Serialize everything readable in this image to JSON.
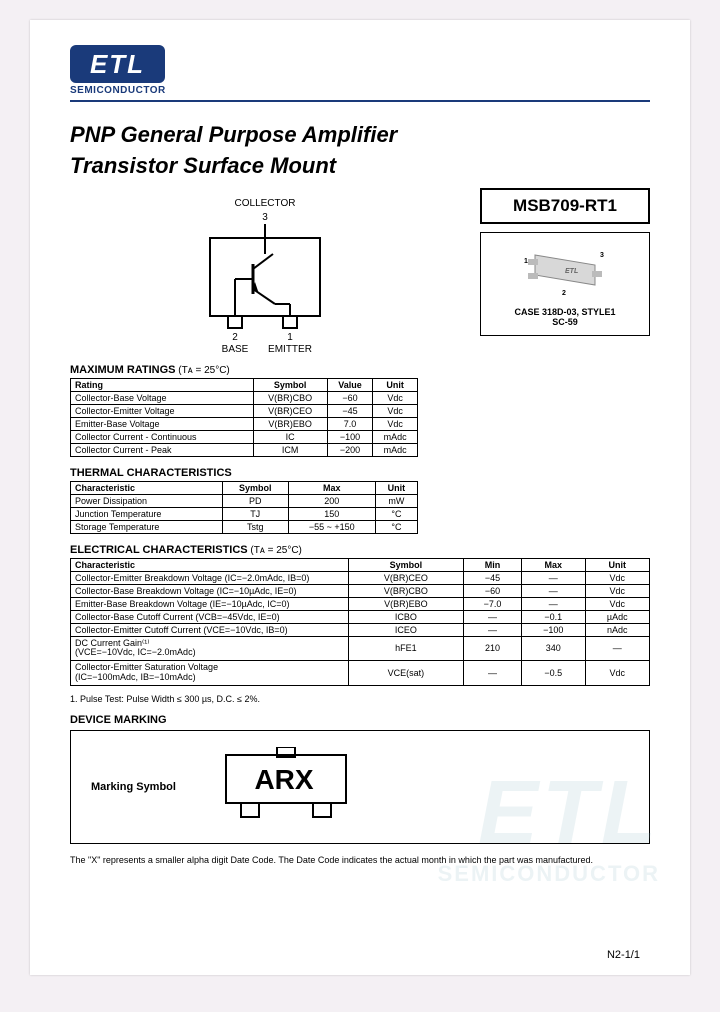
{
  "brand": {
    "mark": "ETL",
    "sub": "SEMICONDUCTOR"
  },
  "title_line1": "PNP General Purpose Amplifier",
  "title_line2": "Transistor Surface Mount",
  "part_number": "MSB709-RT1",
  "package": {
    "case": "CASE 318D-03, STYLE1",
    "type": "SC-59"
  },
  "pins": {
    "p1": "EMITTER",
    "p2": "BASE",
    "p3": "COLLECTOR",
    "n1": "1",
    "n2": "2",
    "n3": "3"
  },
  "sections": {
    "max_ratings": "MAXIMUM RATINGS",
    "max_ratings_cond": " (Tᴀ = 25°C)",
    "thermal": "THERMAL CHARACTERISTICS",
    "electrical": "ELECTRICAL CHARACTERISTICS",
    "electrical_cond": " (Tᴀ = 25°C)",
    "device_marking": "DEVICE MARKING"
  },
  "headers": {
    "rating": "Rating",
    "characteristic": "Characteristic",
    "symbol": "Symbol",
    "value": "Value",
    "min": "Min",
    "max": "Max",
    "unit": "Unit"
  },
  "max_ratings": [
    {
      "rating": "Collector-Base Voltage",
      "symbol": "V(BR)CBO",
      "value": "−60",
      "unit": "Vdc"
    },
    {
      "rating": "Collector-Emitter Voltage",
      "symbol": "V(BR)CEO",
      "value": "−45",
      "unit": "Vdc"
    },
    {
      "rating": "Emitter-Base Voltage",
      "symbol": "V(BR)EBO",
      "value": "7.0",
      "unit": "Vdc"
    },
    {
      "rating": "Collector Current - Continuous",
      "symbol": "IC",
      "value": "−100",
      "unit": "mAdc"
    },
    {
      "rating": "Collector Current - Peak",
      "symbol": "ICM",
      "value": "−200",
      "unit": "mAdc"
    }
  ],
  "thermal": [
    {
      "char": "Power Dissipation",
      "symbol": "PD",
      "max": "200",
      "unit": "mW"
    },
    {
      "char": "Junction Temperature",
      "symbol": "TJ",
      "max": "150",
      "unit": "°C"
    },
    {
      "char": "Storage Temperature",
      "symbol": "Tstg",
      "max": "−55 ~ +150",
      "unit": "°C"
    }
  ],
  "electrical": [
    {
      "char": "Collector-Emitter Breakdown Voltage (IC=−2.0mAdc, IB=0)",
      "symbol": "V(BR)CEO",
      "min": "−45",
      "max": "—",
      "unit": "Vdc"
    },
    {
      "char": "Collector-Base Breakdown Voltage (IC=−10µAdc, IE=0)",
      "symbol": "V(BR)CBO",
      "min": "−60",
      "max": "—",
      "unit": "Vdc"
    },
    {
      "char": "Emitter-Base Breakdown Voltage (IE=−10µAdc, IC=0)",
      "symbol": "V(BR)EBO",
      "min": "−7.0",
      "max": "—",
      "unit": "Vdc"
    },
    {
      "char": "Collector-Base Cutoff Current (VCB=−45Vdc, IE=0)",
      "symbol": "ICBO",
      "min": "—",
      "max": "−0.1",
      "unit": "µAdc"
    },
    {
      "char": "Collector-Emitter Cutoff Current (VCE=−10Vdc, IB=0)",
      "symbol": "ICEO",
      "min": "—",
      "max": "−100",
      "unit": "nAdc"
    },
    {
      "char": "DC Current Gain⁽¹⁾\n(VCE=−10Vdc, IC=−2.0mAdc)",
      "symbol": "hFE1",
      "min": "210",
      "max": "340",
      "unit": "—"
    },
    {
      "char": "Collector-Emitter Saturation Voltage\n(IC=−100mAdc, IB=−10mAdc)",
      "symbol": "VCE(sat)",
      "min": "—",
      "max": "−0.5",
      "unit": "Vdc"
    }
  ],
  "note1": "1. Pulse Test: Pulse Width ≤ 300 µs, D.C. ≤ 2%.",
  "marking": {
    "label": "Marking Symbol",
    "code": "ARX"
  },
  "foot_note": "The \"X\" represents a smaller alpha digit Date Code. The Date Code indicates the actual month in which the part was manufactured.",
  "page_num": "N2-1/1"
}
